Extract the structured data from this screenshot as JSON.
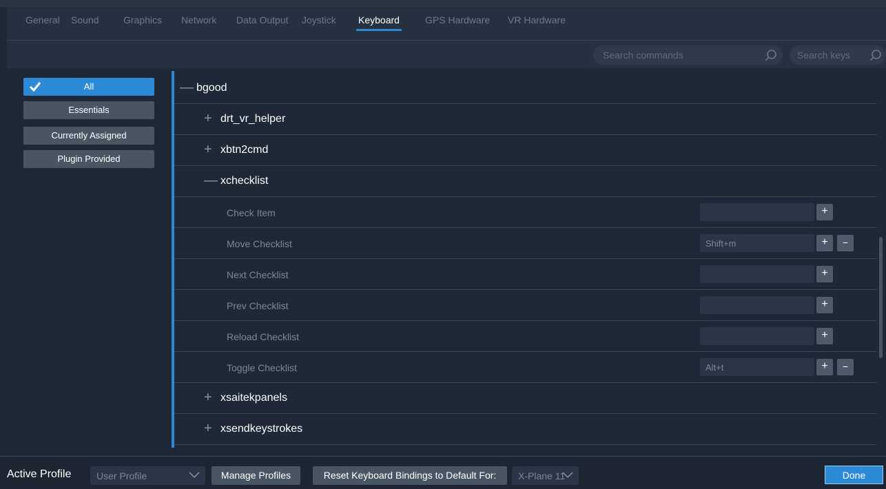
{
  "tabs": [
    {
      "label": "General"
    },
    {
      "label": "Sound"
    },
    {
      "label": "Graphics"
    },
    {
      "label": "Network"
    },
    {
      "label": "Data Output"
    },
    {
      "label": "Joystick"
    },
    {
      "label": "Keyboard",
      "active": true
    },
    {
      "label": "GPS Hardware"
    },
    {
      "label": "VR Hardware"
    }
  ],
  "search": {
    "commands_placeholder": "Search commands",
    "keys_placeholder": "Search keys",
    "icon": "magnifier-icon"
  },
  "filters": [
    {
      "label": "All",
      "active": true,
      "icon": "checkmark-icon"
    },
    {
      "label": "Essentials"
    },
    {
      "label": "Currently Assigned"
    },
    {
      "label": "Plugin Provided"
    }
  ],
  "tree": {
    "root": {
      "symbol": "—",
      "label": "bgood"
    },
    "groups_top": [
      {
        "symbol": "+",
        "label": "drt_vr_helper"
      },
      {
        "symbol": "+",
        "label": "xbtn2cmd"
      },
      {
        "symbol": "—",
        "label": "xchecklist"
      }
    ],
    "commands": [
      {
        "label": "Check Item",
        "key": ""
      },
      {
        "label": "Move Checklist",
        "key": "Shift+m"
      },
      {
        "label": "Next Checklist",
        "key": ""
      },
      {
        "label": "Prev Checklist",
        "key": ""
      },
      {
        "label": "Reload Checklist",
        "key": ""
      },
      {
        "label": "Toggle Checklist",
        "key": "Alt+t"
      }
    ],
    "groups_bottom": [
      {
        "symbol": "+",
        "label": "xsaitekpanels"
      },
      {
        "symbol": "+",
        "label": "xsendkeystrokes"
      }
    ],
    "add_symbol": "+",
    "remove_symbol": "−"
  },
  "bottom": {
    "active_profile_label": "Active Profile",
    "profile_value": "User Profile",
    "manage_profiles": "Manage Profiles",
    "reset_label": "Reset Keyboard Bindings to Default For:",
    "reset_value": "X-Plane 11",
    "done": "Done"
  },
  "colors": {
    "accent": "#2d8ad6",
    "background": "#1e2836",
    "button": "#4a5564"
  }
}
